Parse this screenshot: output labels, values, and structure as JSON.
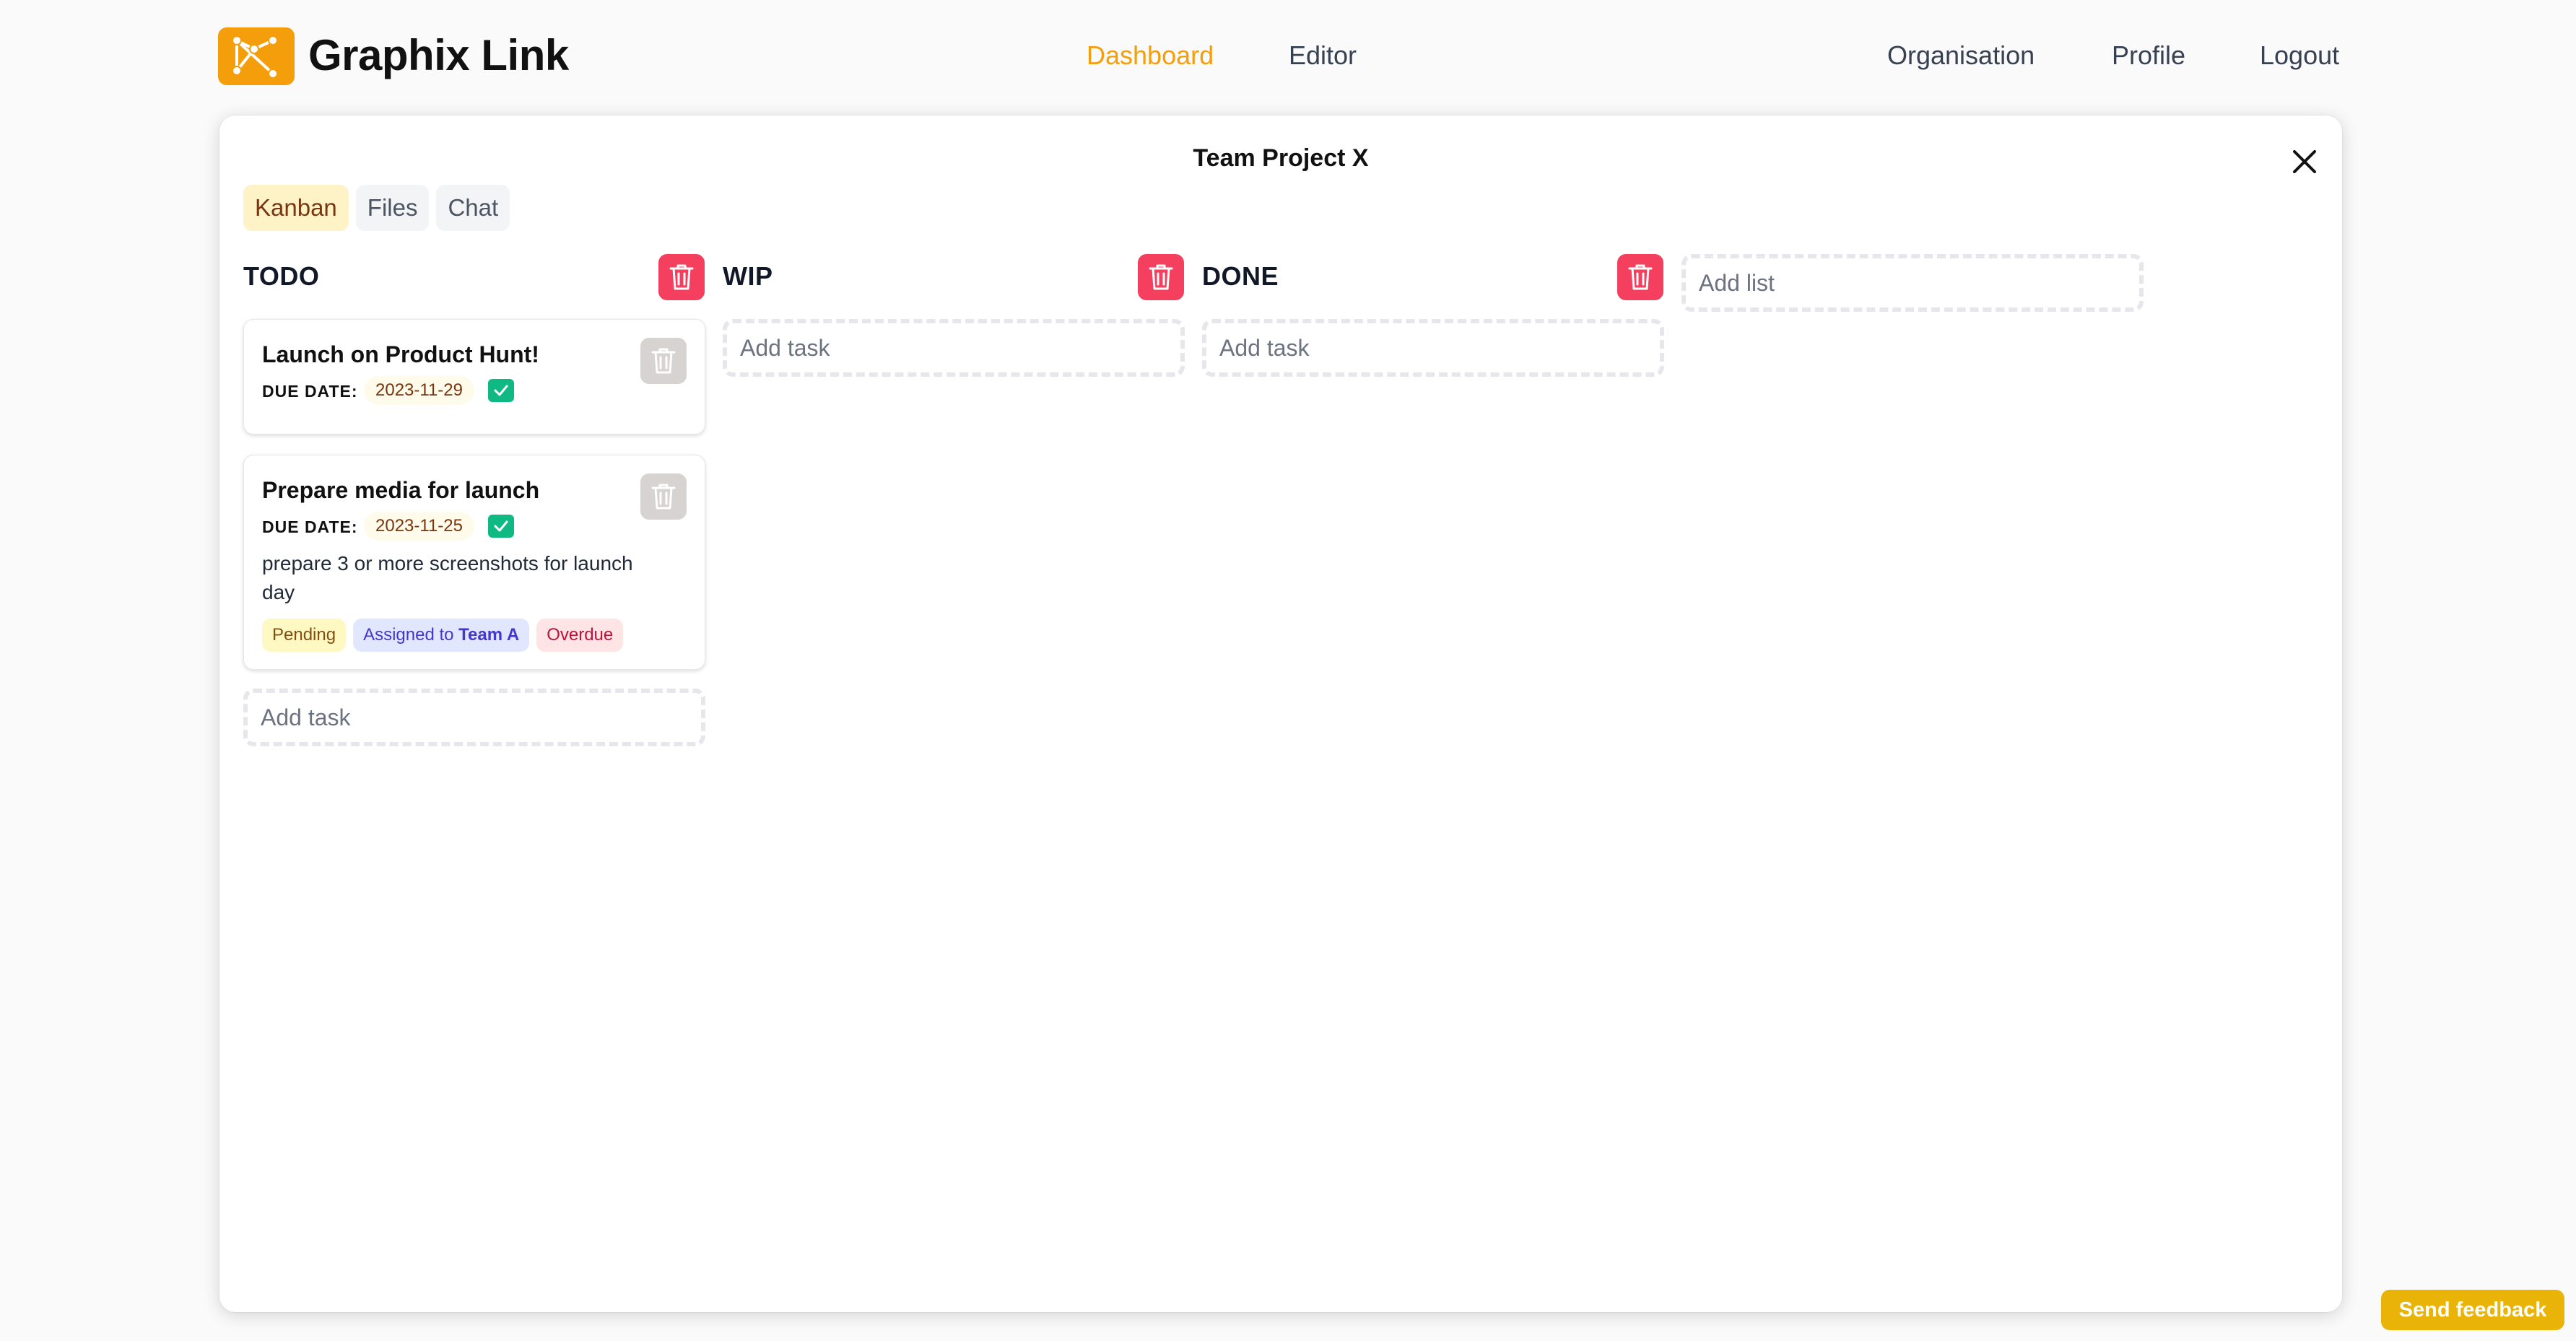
{
  "app": {
    "brand": "Graphix Link",
    "accent_color": "#f59e0b"
  },
  "nav": {
    "dashboard": "Dashboard",
    "editor": "Editor",
    "organisation": "Organisation",
    "profile": "Profile",
    "logout": "Logout"
  },
  "modal": {
    "title": "Team Project X",
    "tabs": [
      {
        "label": "Kanban",
        "active": true
      },
      {
        "label": "Files",
        "active": false
      },
      {
        "label": "Chat",
        "active": false
      }
    ]
  },
  "board": {
    "columns": [
      {
        "title": "TODO"
      },
      {
        "title": "WIP"
      },
      {
        "title": "DONE"
      }
    ],
    "add_task_placeholder": "Add task",
    "add_list_placeholder": "Add list"
  },
  "tasks": [
    {
      "title": "Launch on Product Hunt!",
      "due_label": "DUE DATE:",
      "due_date": "2023-11-29",
      "done": true
    },
    {
      "title": "Prepare media for launch",
      "due_label": "DUE DATE:",
      "due_date": "2023-11-25",
      "done": true,
      "description": "prepare 3 or more screenshots for launch day",
      "badges": {
        "pending": "Pending",
        "assigned_prefix": "Assigned to",
        "assigned_team": "Team A",
        "overdue": "Overdue"
      }
    }
  ],
  "feedback": {
    "label": "Send feedback"
  }
}
